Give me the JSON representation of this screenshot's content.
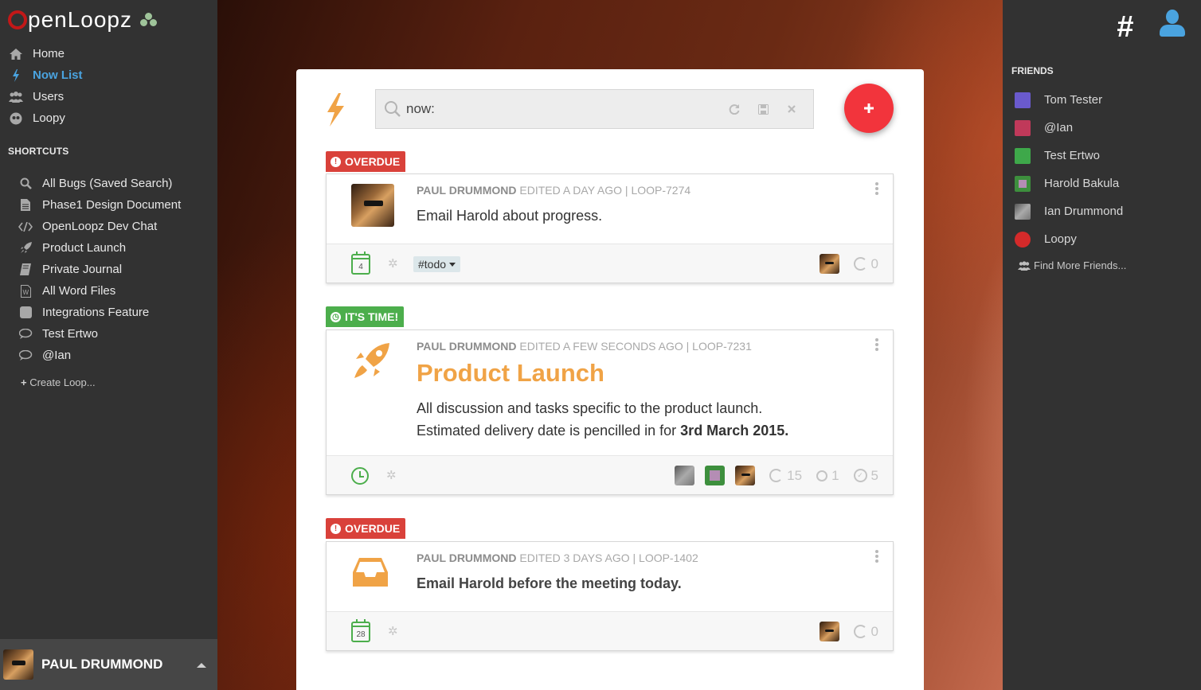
{
  "app": {
    "logo_text": "penLoopz"
  },
  "nav": {
    "items": [
      {
        "label": "Home",
        "icon": "home-icon",
        "active": false
      },
      {
        "label": "Now List",
        "icon": "bolt-icon",
        "active": true
      },
      {
        "label": "Users",
        "icon": "users-icon",
        "active": false
      },
      {
        "label": "Loopy",
        "icon": "loopy-icon",
        "active": false
      }
    ]
  },
  "shortcuts": {
    "title": "SHORTCUTS",
    "items": [
      {
        "label": "All Bugs (Saved Search)",
        "icon": "search-icon"
      },
      {
        "label": "Phase1 Design Document",
        "icon": "document-icon"
      },
      {
        "label": "OpenLoopz Dev Chat",
        "icon": "code-icon"
      },
      {
        "label": "Product Launch",
        "icon": "rocket-icon"
      },
      {
        "label": "Private Journal",
        "icon": "book-icon"
      },
      {
        "label": "All Word Files",
        "icon": "word-file-icon"
      },
      {
        "label": "Integrations Feature",
        "icon": "square-icon"
      },
      {
        "label": "Test Ertwo",
        "icon": "chat-icon"
      },
      {
        "label": "@Ian",
        "icon": "chat-icon"
      }
    ],
    "create_label": "Create Loop..."
  },
  "current_user": {
    "name": "PAUL DRUMMOND"
  },
  "search": {
    "value": "now:"
  },
  "loops": [
    {
      "badge": "OVERDUE",
      "author": "PAUL DRUMMOND",
      "edited": "EDITED A DAY AGO",
      "id": "LOOP-7274",
      "text": "Email Harold about progress.",
      "calendar_day": "4",
      "tag": "#todo",
      "progress_count": "0"
    },
    {
      "badge": "IT'S TIME!",
      "author": "PAUL DRUMMOND",
      "edited": "EDITED A FEW SECONDS AGO",
      "id": "LOOP-7231",
      "title": "Product Launch",
      "line1": "All discussion and tasks specific to the product launch.",
      "line2_prefix": "Estimated delivery date is pencilled in for ",
      "line2_bold": "3rd March 2015",
      "line2_suffix": ".",
      "stat_open": "15",
      "stat_circle": "1",
      "stat_done": "5"
    },
    {
      "badge": "OVERDUE",
      "author": "PAUL DRUMMOND",
      "edited": "EDITED 3 DAYS AGO",
      "id": "LOOP-1402",
      "text": "Email Harold before the meeting today.",
      "calendar_day": "28",
      "progress_count": "0"
    }
  ],
  "friends": {
    "title": "FRIENDS",
    "items": [
      {
        "name": "Tom Tester",
        "color": "#6a5acd"
      },
      {
        "name": "@Ian",
        "color": "#c0395a"
      },
      {
        "name": "Test Ertwo",
        "color": "#3ea84a"
      },
      {
        "name": "Harold Bakula",
        "color": "#3d8f3d"
      },
      {
        "name": "Ian Drummond",
        "color": "#9a9a9a"
      },
      {
        "name": "Loopy",
        "color": "#d42a2a"
      }
    ],
    "find_more_label": "Find More Friends..."
  },
  "colors": {
    "accent_blue": "#4aa3df",
    "overdue_red": "#d9413a",
    "time_green": "#4cae4c",
    "add_button_red": "#f2343c",
    "product_orange": "#f0a346"
  }
}
